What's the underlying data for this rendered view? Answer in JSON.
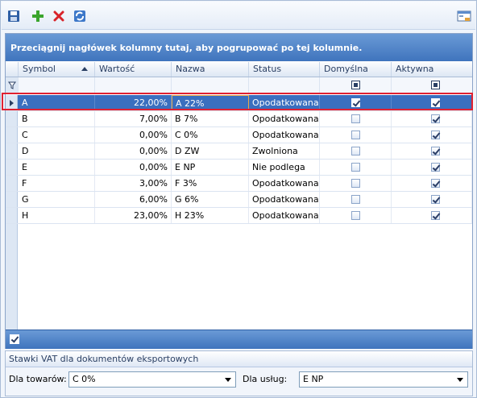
{
  "toolbar": {
    "buttons": [
      {
        "name": "save-button",
        "icon": "floppy-disk-icon"
      },
      {
        "name": "add-button",
        "icon": "plus-icon"
      },
      {
        "name": "delete-button",
        "icon": "x-icon"
      },
      {
        "name": "refresh-button",
        "icon": "refresh-icon"
      }
    ],
    "right_button_icon": "grid-settings-icon"
  },
  "grid": {
    "group_panel_text": "Przeciągnij nagłówek kolumny tutaj, aby pogrupować po tej kolumnie.",
    "columns": [
      "Symbol",
      "Wartość",
      "Nazwa",
      "Status",
      "Domyślna",
      "Aktywna"
    ],
    "sort_column": "Symbol",
    "rows": [
      {
        "symbol": "A",
        "wartosc": "22,00%",
        "nazwa": "A 22%",
        "status": "Opodatkowana",
        "domyslna": true,
        "aktywna": true,
        "selected": true
      },
      {
        "symbol": "B",
        "wartosc": "7,00%",
        "nazwa": "B 7%",
        "status": "Opodatkowana",
        "domyslna": false,
        "aktywna": true,
        "selected": false
      },
      {
        "symbol": "C",
        "wartosc": "0,00%",
        "nazwa": "C 0%",
        "status": "Opodatkowana",
        "domyslna": false,
        "aktywna": true,
        "selected": false
      },
      {
        "symbol": "D",
        "wartosc": "0,00%",
        "nazwa": "D ZW",
        "status": "Zwolniona",
        "domyslna": false,
        "aktywna": true,
        "selected": false
      },
      {
        "symbol": "E",
        "wartosc": "0,00%",
        "nazwa": "E NP",
        "status": "Nie podlega",
        "domyslna": false,
        "aktywna": true,
        "selected": false
      },
      {
        "symbol": "F",
        "wartosc": "3,00%",
        "nazwa": "F 3%",
        "status": "Opodatkowana",
        "domyslna": false,
        "aktywna": true,
        "selected": false
      },
      {
        "symbol": "G",
        "wartosc": "6,00%",
        "nazwa": "G 6%",
        "status": "Opodatkowana",
        "domyslna": false,
        "aktywna": true,
        "selected": false
      },
      {
        "symbol": "H",
        "wartosc": "23,00%",
        "nazwa": "H 23%",
        "status": "Opodatkowana",
        "domyslna": false,
        "aktywna": true,
        "selected": false
      }
    ]
  },
  "export": {
    "title": "Stawki VAT dla dokumentów eksportowych",
    "goods_label": "Dla towarów:",
    "goods_value": "C 0%",
    "services_label": "Dla usług:",
    "services_value": "E NP"
  },
  "colors": {
    "selection": "#3a6fbf",
    "highlight_border": "#e02030",
    "header_band": "#4f82c8"
  }
}
